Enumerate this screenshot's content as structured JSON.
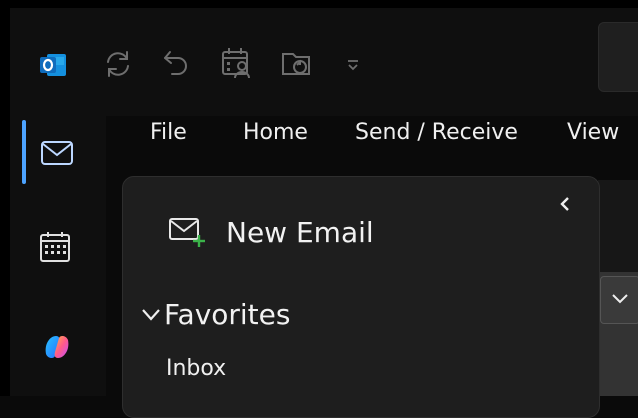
{
  "quick_access": {
    "app_icon": "outlook-logo-icon",
    "items": [
      {
        "name": "sync-icon"
      },
      {
        "name": "undo-icon"
      },
      {
        "name": "calendar-person-icon"
      },
      {
        "name": "folder-sync-icon"
      },
      {
        "name": "customize-dropdown-icon"
      }
    ]
  },
  "menu": {
    "tabs": [
      "File",
      "Home",
      "Send / Receive",
      "View"
    ]
  },
  "rail": {
    "items": [
      "mail-icon",
      "calendar-icon",
      "copilot-icon"
    ]
  },
  "pane": {
    "new_email_label": "New Email",
    "favorites_label": "Favorites",
    "inbox_label": "Inbox",
    "collapse_glyph": "‹",
    "dropdown_glyph": "⌄"
  },
  "colors": {
    "accent": "#4da3ff",
    "outlook_blue": "#0f6cbd",
    "new_email_plus": "#3bb34a"
  }
}
